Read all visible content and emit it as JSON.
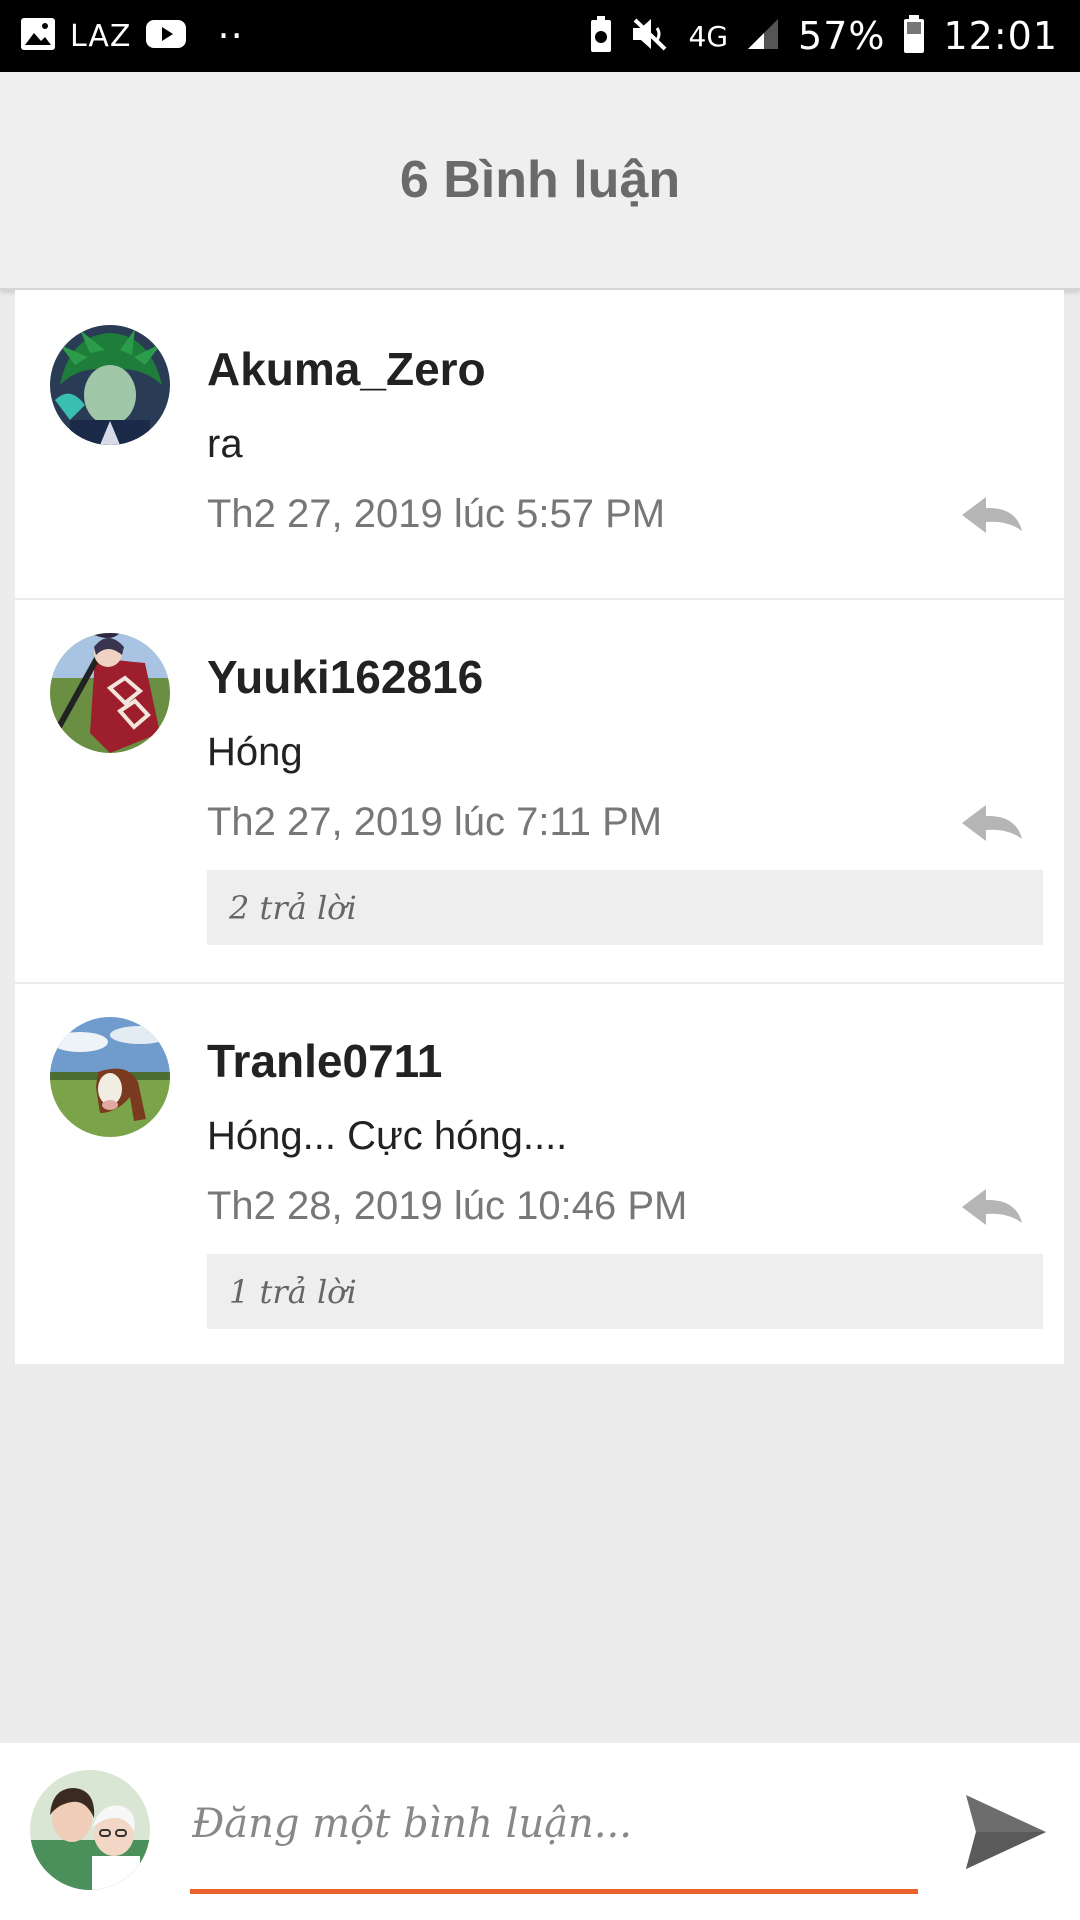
{
  "status_bar": {
    "carrier_label": "LAZ",
    "dots": "··",
    "network": "4G",
    "battery_percent": "57%",
    "time": "12:01"
  },
  "header": {
    "title": "6 Bình luận"
  },
  "comments": [
    {
      "username": "Akuma_Zero",
      "text": "ra",
      "time": "Th2 27, 2019 lúc 5:57 PM",
      "replies_label": ""
    },
    {
      "username": "Yuuki162816",
      "text": "Hóng",
      "time": "Th2 27, 2019 lúc 7:11 PM",
      "replies_label": "2 trả lời"
    },
    {
      "username": "Tranle0711",
      "text": "Hóng... Cực hóng....",
      "time": "Th2 28, 2019 lúc 10:46 PM",
      "replies_label": "1 trả lời"
    }
  ],
  "composer": {
    "placeholder": "Đăng một bình luận...",
    "accent_color": "#e8622a"
  },
  "icons": {
    "status_left": [
      "image-icon",
      "youtube-icon"
    ],
    "status_right": [
      "battery-saver-icon",
      "mute-icon",
      "signal-icon",
      "battery-icon"
    ],
    "reply": "reply-arrow-icon",
    "send": "send-icon"
  }
}
